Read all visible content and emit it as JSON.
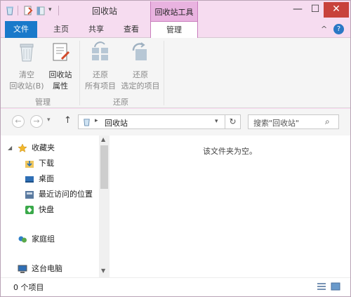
{
  "window": {
    "title": "回收站",
    "context_tab_group": "回收站工具",
    "controls": {
      "minimize": "—",
      "maximize": "☐",
      "close": "✕"
    }
  },
  "ribbon_tabs": [
    "文件",
    "主页",
    "共享",
    "查看",
    "管理"
  ],
  "ribbon_right": {
    "collapse": "^",
    "help": "?"
  },
  "ribbon": {
    "groups": [
      {
        "label": "管理",
        "buttons": [
          {
            "line1": "清空",
            "line2": "回收站(B)",
            "icon": "recycle-bin-icon",
            "enabled": false
          },
          {
            "line1": "回收站",
            "line2": "属性",
            "icon": "properties-icon",
            "enabled": true
          }
        ]
      },
      {
        "label": "还原",
        "buttons": [
          {
            "line1": "还原",
            "line2": "所有项目",
            "icon": "restore-all-icon",
            "enabled": false
          },
          {
            "line1": "还原",
            "line2": "选定的项目",
            "icon": "restore-selected-icon",
            "enabled": false
          }
        ]
      }
    ]
  },
  "address": {
    "back": "←",
    "forward": "→",
    "dropdown": "▾",
    "up": "↑",
    "crumb_sep": "▸",
    "location": "回收站",
    "refresh": "↻"
  },
  "search": {
    "placeholder": "搜索\"回收站\"",
    "icon": "⌕"
  },
  "nav_pane": {
    "favorites_label": "收藏夹",
    "favorites": [
      {
        "label": "下载",
        "icon": "download-folder-icon"
      },
      {
        "label": "桌面",
        "icon": "desktop-icon"
      },
      {
        "label": "最近访问的位置",
        "icon": "recent-places-icon"
      },
      {
        "label": "快盘",
        "icon": "kuaipan-icon"
      }
    ],
    "homegroup": "家庭组",
    "thispc": "这台电脑"
  },
  "content": {
    "empty_message": "该文件夹为空。"
  },
  "status": {
    "item_count": "0 个项目"
  },
  "colors": {
    "title_bg": "#f6dcf0",
    "context_tab": "#e9b3e0",
    "file_tab": "#1979ca",
    "close_btn": "#c8423c"
  }
}
